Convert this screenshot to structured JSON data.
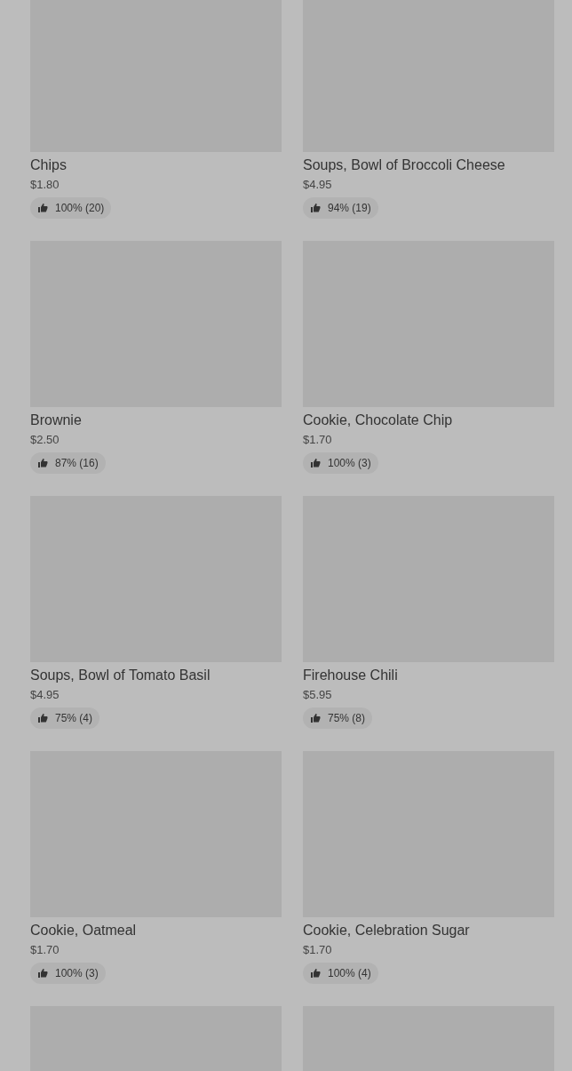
{
  "menu_items": [
    {
      "name": "Chips",
      "price": "$1.80",
      "rating": "100% (20)"
    },
    {
      "name": "Soups, Bowl of Broccoli Cheese",
      "price": "$4.95",
      "rating": "94% (19)"
    },
    {
      "name": "Brownie",
      "price": "$2.50",
      "rating": "87% (16)"
    },
    {
      "name": "Cookie, Chocolate Chip",
      "price": "$1.70",
      "rating": "100% (3)"
    },
    {
      "name": "Soups, Bowl of Tomato Basil",
      "price": "$4.95",
      "rating": "75% (4)"
    },
    {
      "name": "Firehouse Chili",
      "price": "$5.95",
      "rating": "75% (8)"
    },
    {
      "name": "Cookie, Oatmeal",
      "price": "$1.70",
      "rating": "100% (3)"
    },
    {
      "name": "Cookie, Celebration Sugar",
      "price": "$1.70",
      "rating": "100% (4)"
    }
  ]
}
